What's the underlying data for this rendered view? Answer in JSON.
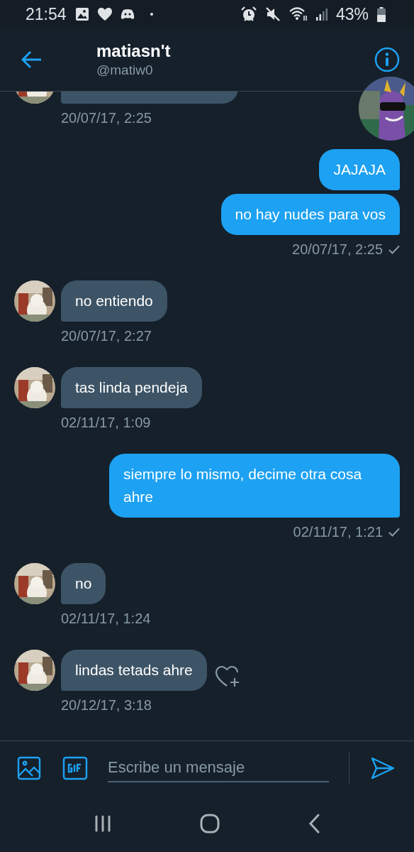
{
  "status_bar": {
    "time": "21:54",
    "battery": "43%"
  },
  "header": {
    "name": "matiasn't",
    "handle": "@matiw0"
  },
  "messages": [
    {
      "kind": "received_clipped",
      "time": "20/07/17, 2:25"
    },
    {
      "kind": "sent",
      "texts": [
        "JAJAJA",
        "no hay nudes para vos"
      ],
      "time": "20/07/17, 2:25",
      "read": true
    },
    {
      "kind": "received",
      "texts": [
        "no entiendo"
      ],
      "time": "20/07/17, 2:27"
    },
    {
      "kind": "received",
      "texts": [
        "tas linda pendeja"
      ],
      "time": "02/11/17, 1:09"
    },
    {
      "kind": "sent",
      "texts": [
        "siempre lo mismo, decime otra cosa ahre"
      ],
      "time": "02/11/17, 1:21",
      "read": true
    },
    {
      "kind": "received",
      "texts": [
        "no"
      ],
      "time": "02/11/17, 1:24"
    },
    {
      "kind": "received",
      "texts": [
        "lindas tetads ahre"
      ],
      "time": "20/12/17, 3:18",
      "reaction_button": true
    }
  ],
  "composer": {
    "placeholder": "Escribe un mensaje"
  }
}
